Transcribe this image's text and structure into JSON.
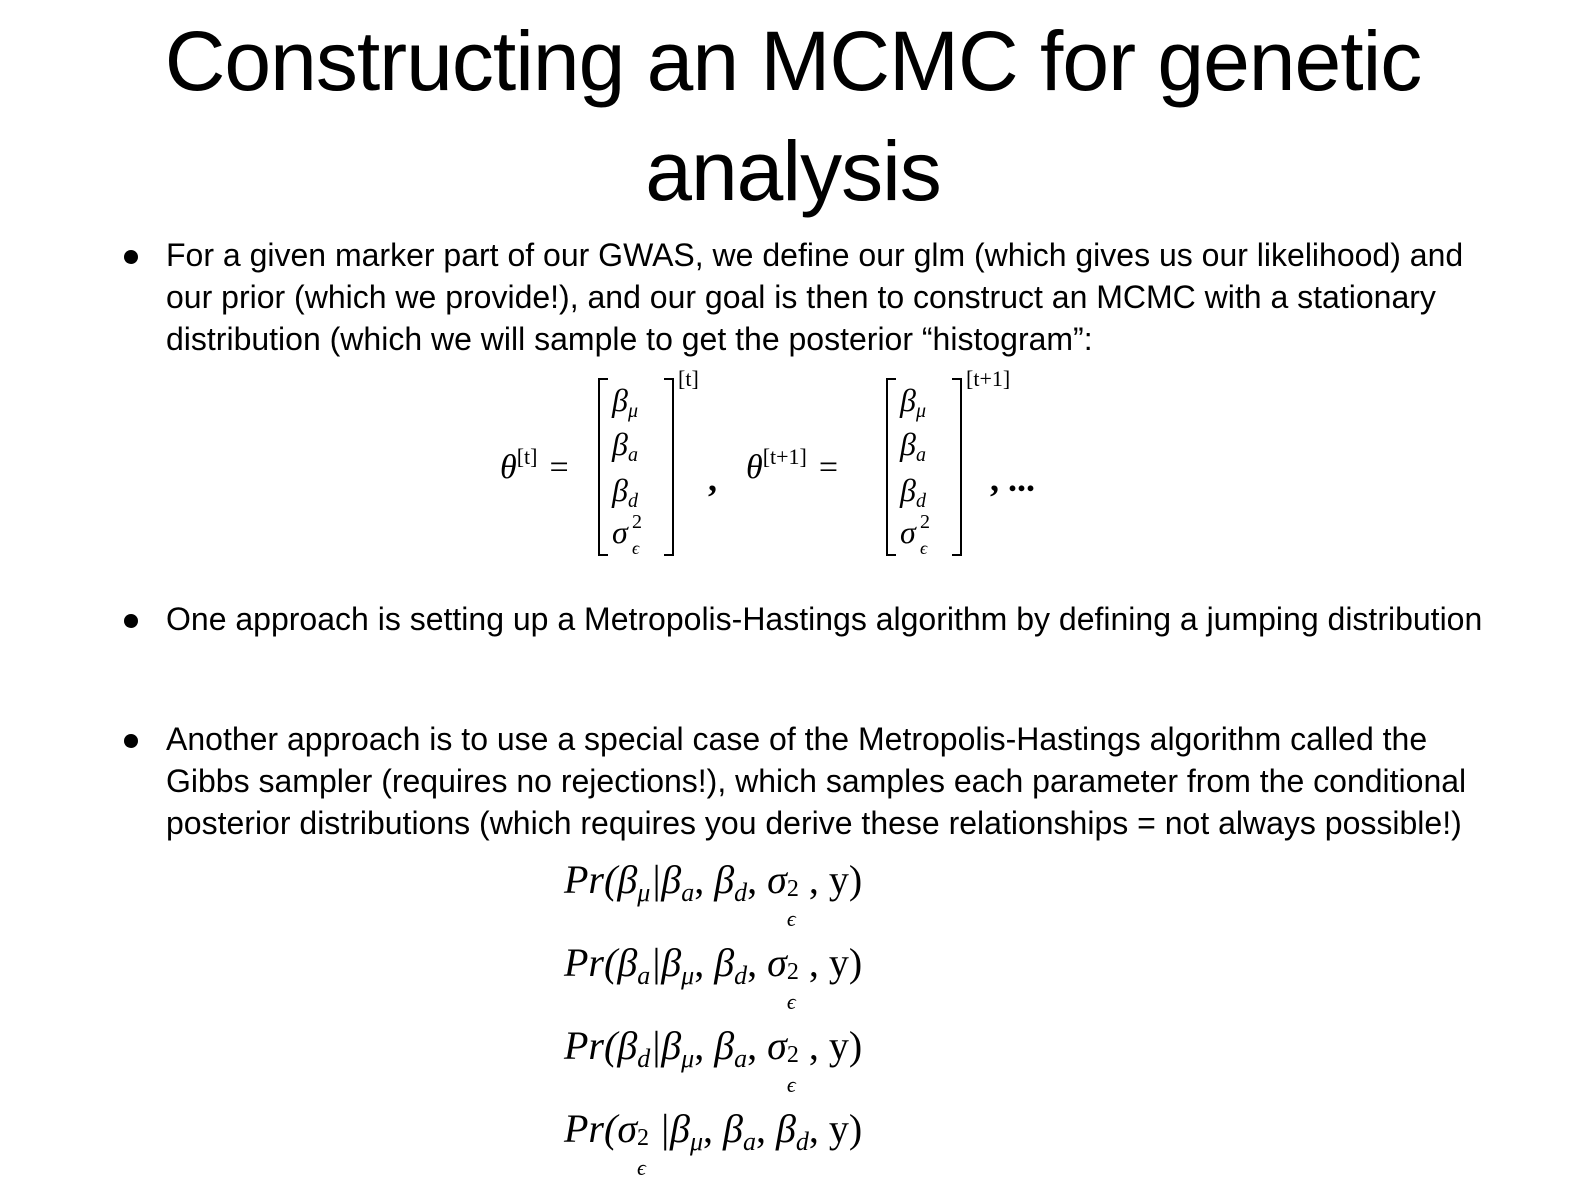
{
  "slide": {
    "title": "Constructing an MCMC for genetic analysis",
    "bullets": [
      "For a given marker part of our GWAS, we define our glm (which gives us our likelihood) and our prior (which we provide!), and our goal is then to construct an MCMC with a stationary distribution (which we will sample to get the posterior “histogram”:",
      "One approach is setting up a Metropolis-Hastings algorithm by defining a jumping distribution",
      "Another approach is to use a special case of the Metropolis-Hastings algorithm called the Gibbs sampler (requires no rejections!), which samples each parameter from the conditional posterior distributions (which requires you derive these relationships = not always possible!)"
    ],
    "theta_equation": {
      "lhs1": "θ",
      "sup1": "[t]",
      "lhs2": "θ",
      "sup2": "[t+1]",
      "equals": "=",
      "entries": [
        "β",
        "β",
        "β",
        "σ"
      ],
      "entry_subs": [
        "μ",
        "a",
        "d",
        "ϵ"
      ],
      "square": "2",
      "exp1": "[t]",
      "exp2": "[t+1]",
      "sep": ",",
      "ellipsis": ", ..."
    },
    "conditionals": [
      {
        "text_pre": "Pr(β",
        "target_sub": "μ",
        "given": "|β",
        "g1": "a",
        "g2": "d",
        "sig": "σ",
        "tail": ", y)"
      },
      {
        "text_pre": "Pr(β",
        "target_sub": "a",
        "given": "|β",
        "g1": "μ",
        "g2": "d",
        "sig": "σ",
        "tail": ", y)"
      },
      {
        "text_pre": "Pr(β",
        "target_sub": "d",
        "given": "|β",
        "g1": "μ",
        "g2": "a",
        "sig": "σ",
        "tail": ", y)"
      },
      {
        "text_pre": "Pr(σ",
        "g1": "μ",
        "g2": "a",
        "g3": "d",
        "tail": ", y)"
      }
    ]
  }
}
